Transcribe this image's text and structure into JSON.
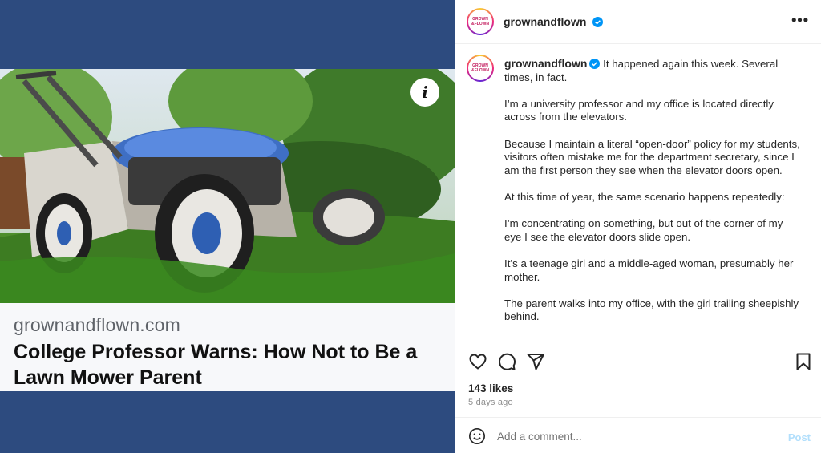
{
  "media": {
    "image_subject": "lawn-mower-photo",
    "info_icon": "i",
    "link_card": {
      "domain": "grownandflown.com",
      "title": "College Professor Warns: How Not to Be a Lawn Mower Parent"
    },
    "colors": {
      "backdrop": "#2d4b7f",
      "card_bg": "#f7f8fa"
    }
  },
  "header": {
    "avatar_text_1": "GROWN",
    "avatar_text_2": "&FLOWN",
    "username": "grownandflown",
    "verified_icon": "verified-badge-icon",
    "more_label": "•••"
  },
  "caption": {
    "username": "grownandflown",
    "first_line": "It happened again this week. Several times, in fact.",
    "paragraphs": [
      "I’m a university professor and my office is located directly across from the elevators.",
      "Because I maintain a literal “open-door” policy for my students, visitors often mistake me for the department secretary, since I am the first person they see when the elevator doors open.",
      "At this time of year, the same scenario happens repeatedly:",
      "I’m concentrating on something, but out of the corner of my eye I see the elevator doors slide open.",
      "It’s a teenage girl and a middle-aged woman, presumably her mother.",
      "The parent walks into my office, with the girl trailing sheepishly behind."
    ]
  },
  "actions": {
    "icons": [
      "heart-icon",
      "comment-icon",
      "share-icon",
      "bookmark-icon"
    ],
    "likes": "143 likes",
    "timestamp": "5 days ago"
  },
  "comment": {
    "placeholder": "Add a comment...",
    "post_label": "Post",
    "emoji_icon": "smiley-icon"
  },
  "colors": {
    "verified": "#0095f6",
    "post_disabled": "#b2dffc"
  }
}
